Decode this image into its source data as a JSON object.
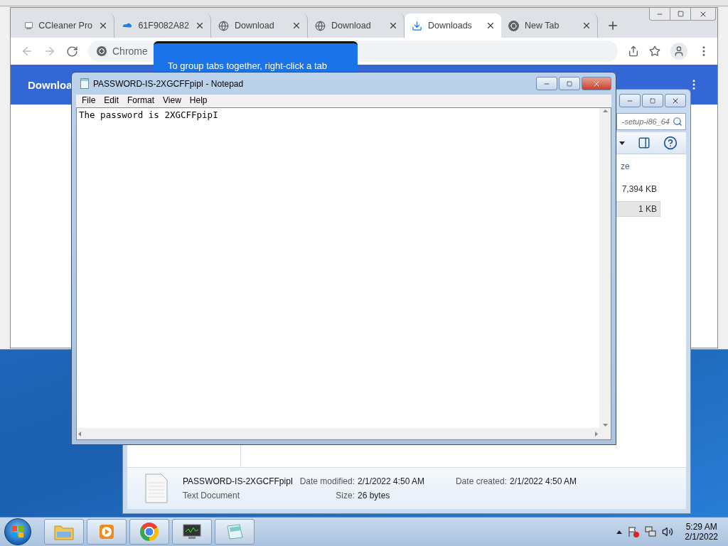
{
  "chrome": {
    "tabs": [
      {
        "title": "CCleaner Pro",
        "kind": "app",
        "selected": false
      },
      {
        "title": "61F9082A82",
        "kind": "cloud",
        "selected": false
      },
      {
        "title": "Download",
        "kind": "globe",
        "selected": false
      },
      {
        "title": "Download",
        "kind": "globe",
        "selected": false
      },
      {
        "title": "Downloads",
        "kind": "download",
        "selected": true
      },
      {
        "title": "New Tab",
        "kind": "chrome",
        "selected": false
      }
    ],
    "omnibox": "Chrome",
    "page_header": "Downloa",
    "tooltip": "To group tabs together, right-click a tab"
  },
  "explorer": {
    "search": "-setup-i86_64",
    "column": "ze",
    "sizes": [
      {
        "text": "7,394 KB",
        "selected": false
      },
      {
        "text": "1 KB",
        "selected": true
      }
    ],
    "details": {
      "name": "PASSWORD-IS-2XGCFFpipI",
      "type": "Text Document",
      "fields": [
        {
          "label": "Date modified:",
          "value": "2/1/2022 4:50 AM"
        },
        {
          "label": "Date created:",
          "value": "2/1/2022 4:50 AM"
        },
        {
          "label": "Size:",
          "value": "26 bytes"
        }
      ]
    }
  },
  "notepad": {
    "title": "PASSWORD-IS-2XGCFFpipI - Notepad",
    "menu": [
      "File",
      "Edit",
      "Format",
      "View",
      "Help"
    ],
    "text": "The password is 2XGCFFpipI"
  },
  "taskbar": {
    "apps": [
      {
        "kind": "explorer"
      },
      {
        "kind": "media"
      },
      {
        "kind": "chrome"
      },
      {
        "kind": "monitor"
      },
      {
        "kind": "notepad"
      }
    ],
    "time": "5:29 AM",
    "date": "2/1/2022"
  }
}
